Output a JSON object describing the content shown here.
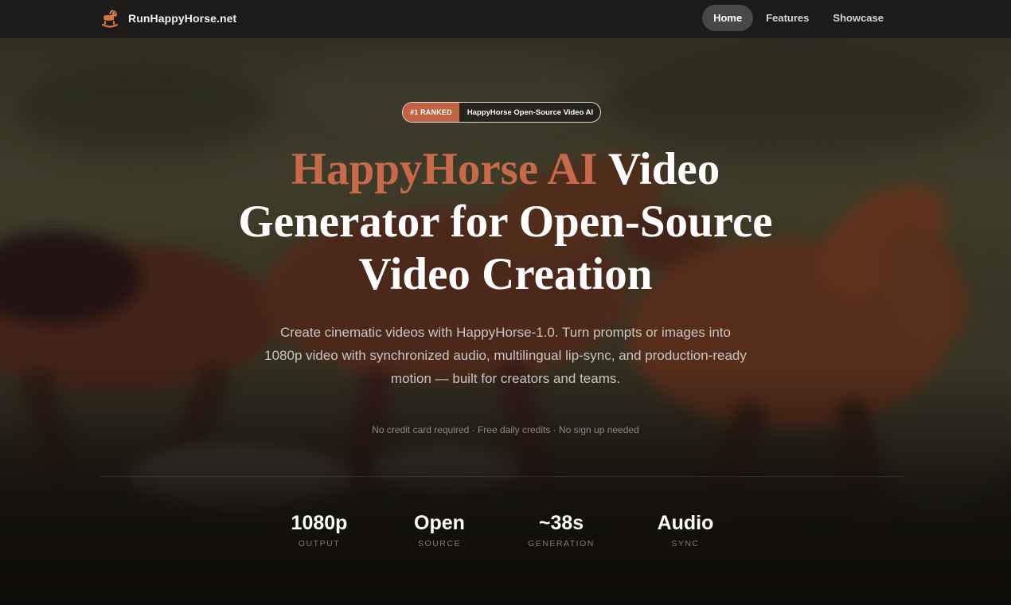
{
  "nav": {
    "brand": "RunHappyHorse.net",
    "links": [
      {
        "label": "Home",
        "active": true
      },
      {
        "label": "Features",
        "active": false
      },
      {
        "label": "Showcase",
        "active": false
      }
    ]
  },
  "hero": {
    "badge_tag": "#1 RANKED",
    "badge_text": "HappyHorse Open-Source Video AI",
    "headline_accent": "HappyHorse AI",
    "headline_rest": "Video Generator for Open-Source Video Creation",
    "subhead": "Create cinematic videos with HappyHorse-1.0. Turn prompts or images into 1080p video with synchronized audio, multilingual lip-sync, and production-ready motion — built for creators and teams.",
    "fineprint": "No credit card required · Free daily credits · No sign up needed"
  },
  "stats": [
    {
      "value": "1080p",
      "label": "OUTPUT"
    },
    {
      "value": "Open",
      "label": "SOURCE"
    },
    {
      "value": "~38s",
      "label": "GENERATION"
    },
    {
      "value": "Audio",
      "label": "SYNC"
    }
  ],
  "colors": {
    "accent": "#c8694a",
    "badge_tag_bg": "#c0623f",
    "nav_bg": "#1c1b1a",
    "active_pill": "#4a4846"
  },
  "icons": {
    "brand": "rocking-horse-icon"
  }
}
